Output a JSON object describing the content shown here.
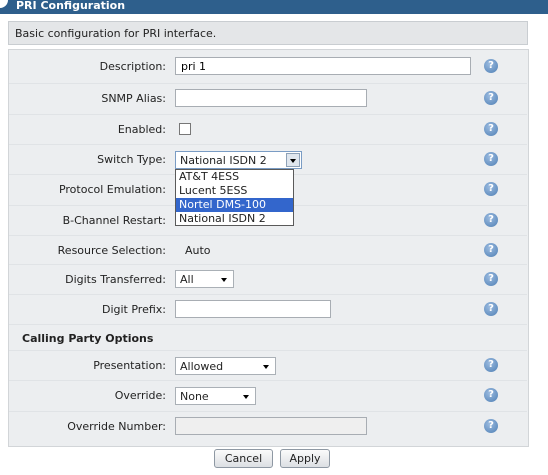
{
  "title": "PRI Configuration",
  "description": "Basic configuration for PRI interface.",
  "help_glyph": "?",
  "fields": {
    "description": {
      "label": "Description:",
      "value": "pri 1"
    },
    "snmp_alias": {
      "label": "SNMP Alias:",
      "value": ""
    },
    "enabled": {
      "label": "Enabled:",
      "checked": false
    },
    "switch_type": {
      "label": "Switch Type:",
      "value": "National ISDN 2",
      "options": [
        "AT&T 4ESS",
        "Lucent 5ESS",
        "Nortel DMS-100",
        "National ISDN 2"
      ],
      "highlighted": "Nortel DMS-100"
    },
    "protocol_emulation": {
      "label": "Protocol Emulation:"
    },
    "b_channel_restart": {
      "label": "B-Channel Restart:"
    },
    "resource_selection": {
      "label": "Resource Selection:",
      "value": "Auto"
    },
    "digits_transferred": {
      "label": "Digits Transferred:",
      "value": "All"
    },
    "digit_prefix": {
      "label": "Digit Prefix:",
      "value": ""
    }
  },
  "calling_party": {
    "heading": "Calling Party Options",
    "presentation": {
      "label": "Presentation:",
      "value": "Allowed"
    },
    "override": {
      "label": "Override:",
      "value": "None"
    },
    "override_number": {
      "label": "Override Number:",
      "value": ""
    }
  },
  "buttons": {
    "cancel": "Cancel",
    "apply": "Apply"
  },
  "colors": {
    "titlebar": "#2e5f8c",
    "highlight": "#3366cc",
    "help_icon": "#4f7fb4"
  }
}
